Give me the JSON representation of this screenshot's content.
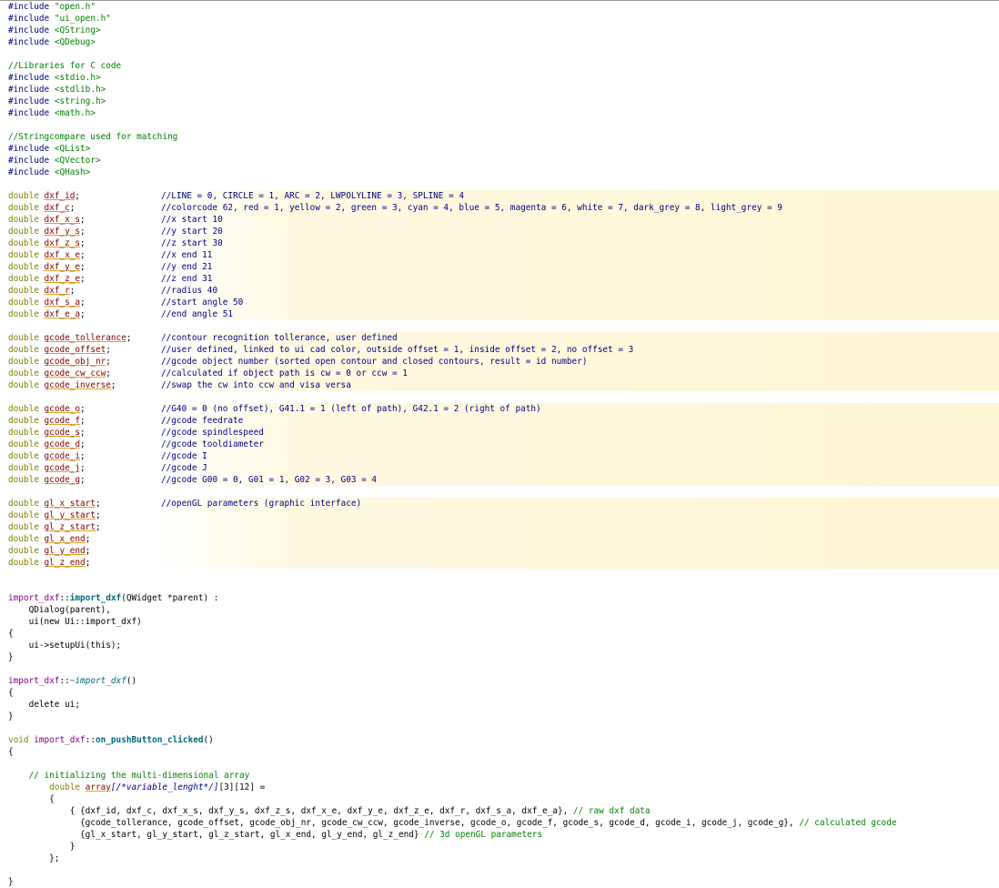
{
  "editor": {
    "includes": [
      {
        "directive": "#include",
        "target": "\"open.h\""
      },
      {
        "directive": "#include",
        "target": "\"ui_open.h\""
      },
      {
        "directive": "#include",
        "target": "<QString>"
      },
      {
        "directive": "#include",
        "target": "<QDebug>"
      }
    ],
    "comment_libraries": "//Libraries for C code",
    "c_includes": [
      {
        "directive": "#include",
        "target": "<stdio.h>"
      },
      {
        "directive": "#include",
        "target": "<stdlib.h>"
      },
      {
        "directive": "#include",
        "target": "<string.h>"
      },
      {
        "directive": "#include",
        "target": "<math.h>"
      }
    ],
    "comment_stringcompare": "//Stringcompare used for matching",
    "qt_includes": [
      {
        "directive": "#include",
        "target": "<QList>"
      },
      {
        "directive": "#include",
        "target": "<QVector>"
      },
      {
        "directive": "#include",
        "target": "<QHash>"
      }
    ],
    "type_keyword": "double",
    "dxf_vars": [
      {
        "name": "dxf_id",
        "comment": "//LINE = 0, CIRCLE = 1, ARC = 2, LWPOLYLINE = 3, SPLINE = 4"
      },
      {
        "name": "dxf_c",
        "comment": "//colorcode 62, red = 1, yellow = 2, green = 3, cyan = 4, blue = 5, magenta = 6, white = 7, dark_grey = 8, light_grey = 9"
      },
      {
        "name": "dxf_x_s",
        "comment": "//x start 10"
      },
      {
        "name": "dxf_y_s",
        "comment": "//y start 20"
      },
      {
        "name": "dxf_z_s",
        "comment": "//z start 30"
      },
      {
        "name": "dxf_x_e",
        "comment": "//x end 11"
      },
      {
        "name": "dxf_y_e",
        "comment": "//y end 21"
      },
      {
        "name": "dxf_z_e",
        "comment": "//z end 31"
      },
      {
        "name": "dxf_r",
        "comment": "//radius 40"
      },
      {
        "name": "dxf_s_a",
        "comment": "//start angle 50"
      },
      {
        "name": "dxf_e_a",
        "comment": "//end angle 51"
      }
    ],
    "gcode_vars_a": [
      {
        "name": "gcode_tollerance",
        "comment": "//contour recognition tollerance, user defined"
      },
      {
        "name": "gcode_offset",
        "comment": "//user defined, linked to ui cad color, outside offset = 1, inside offset = 2, no offset = 3"
      },
      {
        "name": "gcode_obj_nr",
        "comment": "//gcode object number (sorted open contour and closed contours, result = id number)"
      },
      {
        "name": "gcode_cw_ccw",
        "comment": "//calculated if object path is cw = 0 or ccw = 1"
      },
      {
        "name": "gcode_inverse",
        "comment": "//swap the cw into ccw and visa versa"
      }
    ],
    "gcode_vars_b": [
      {
        "name": "gcode_o",
        "comment": "//G40 = 0 (no offset), G41.1 = 1 (left of path), G42.1 = 2 (right of path)"
      },
      {
        "name": "gcode_f",
        "comment": "//gcode feedrate"
      },
      {
        "name": "gcode_s",
        "comment": "//gcode spindlespeed"
      },
      {
        "name": "gcode_d",
        "comment": "//gcode tooldiameter"
      },
      {
        "name": "gcode_i",
        "comment": "//gcode I"
      },
      {
        "name": "gcode_j",
        "comment": "//gcode J"
      },
      {
        "name": "gcode_g",
        "comment": "//gcode G00 = 0, G01 = 1, G02 = 3, G03 = 4"
      }
    ],
    "gl_vars": [
      {
        "name": "gl_x_start",
        "comment": "//openGL parameters (graphic interface)"
      },
      {
        "name": "gl_y_start",
        "comment": ""
      },
      {
        "name": "gl_z_start",
        "comment": ""
      },
      {
        "name": "gl_x_end",
        "comment": ""
      },
      {
        "name": "gl_y_end",
        "comment": ""
      },
      {
        "name": "gl_z_end",
        "comment": ""
      }
    ],
    "ctor": {
      "class": "import_dxf",
      "func": "import_dxf",
      "params": "(QWidget *parent) :",
      "init1": "QDialog(parent),",
      "init2": "ui(new Ui::import_dxf)",
      "body": "ui->setupUi(this);"
    },
    "dtor": {
      "class": "import_dxf",
      "func": "~import_dxf",
      "tail": "()",
      "body": "delete ui;"
    },
    "slot": {
      "ret": "void",
      "class": "import_dxf",
      "func": "on_pushButton_clicked",
      "tail": "()"
    },
    "array_comment": "// initializing the multi-dimensional array",
    "array_decl_name": "array",
    "array_decl_doc": "[/*variable_lenght*/]",
    "array_decl_dims": "[3][12] =",
    "row1": "{dxf_id, dxf_c, dxf_x_s, dxf_y_s, dxf_z_s, dxf_x_e, dxf_y_e, dxf_z_e, dxf_r, dxf_s_a, dxf_e_a},",
    "row1_comment": "// raw dxf data",
    "row2": "{gcode_tollerance, gcode_offset, gcode_obj_nr, gcode_cw_ccw, gcode_inverse, gcode_o, gcode_f, gcode_s, gcode_d, gcode_i, gcode_j, gcode_g},",
    "row2_comment": "// calculated gcode",
    "row3": "{gl_x_start, gl_y_start, gl_z_start, gl_x_end, gl_y_end, gl_z_end}",
    "row3_comment": "// 3d openGL parameters"
  }
}
